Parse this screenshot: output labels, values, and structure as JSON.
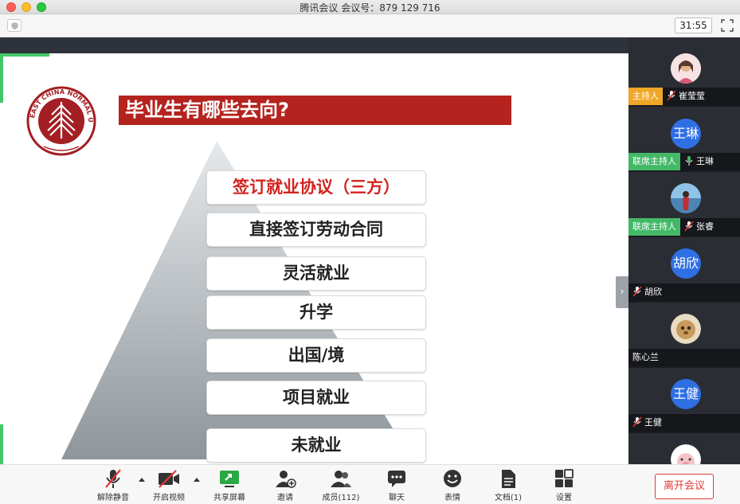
{
  "window": {
    "title": "腾讯会议 会议号：879 129 716"
  },
  "topbar": {
    "timer": "31:55"
  },
  "slide": {
    "title": "毕业生有哪些去向?",
    "levels": [
      {
        "label": "签订就业协议（三方）",
        "highlight": true
      },
      {
        "label": "直接签订劳动合同"
      },
      {
        "label": "灵活就业"
      },
      {
        "label": "升学"
      },
      {
        "label": "出国/境"
      },
      {
        "label": "项目就业"
      },
      {
        "label": "未就业"
      }
    ]
  },
  "participants": [
    {
      "name": "崔莹莹",
      "role": "主持人",
      "avatar_type": "photo",
      "mic": "muted"
    },
    {
      "name": "王琳",
      "role": "联席主持人",
      "avatar_text": "王琳",
      "avatar_type": "initials",
      "mic": "active"
    },
    {
      "name": "张睿",
      "role": "联席主持人",
      "avatar_type": "photo",
      "mic": "muted"
    },
    {
      "name": "胡欣",
      "role": "",
      "avatar_text": "胡欣",
      "avatar_type": "initials",
      "mic": "muted"
    },
    {
      "name": "陈心兰",
      "role": "",
      "avatar_type": "photo",
      "mic": "none"
    },
    {
      "name": "王健",
      "role": "",
      "avatar_text": "王健",
      "avatar_type": "initials",
      "mic": "muted"
    }
  ],
  "toolbar": {
    "unmute": "解除静音",
    "video": "开启视频",
    "share": "共享屏幕",
    "invite": "邀请",
    "members": "成员(112)",
    "chat": "聊天",
    "emoji": "表情",
    "docs": "文档(1)",
    "settings": "设置",
    "leave": "离开会议"
  },
  "colors": {
    "accent_red": "#b5231f",
    "host_badge": "#f0a727",
    "cohost_badge": "#43b968",
    "avatar_blue": "#2f6fe4",
    "leave_red": "#e03b35"
  }
}
